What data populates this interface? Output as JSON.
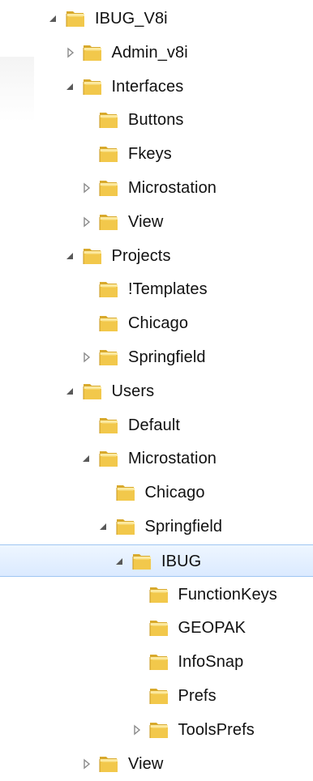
{
  "tree": {
    "items": [
      {
        "label": "IBUG_V8i",
        "expander": "expanded"
      },
      {
        "label": "Admin_v8i",
        "expander": "collapsed"
      },
      {
        "label": "Interfaces",
        "expander": "expanded"
      },
      {
        "label": "Buttons",
        "expander": "none"
      },
      {
        "label": "Fkeys",
        "expander": "none"
      },
      {
        "label": "Microstation",
        "expander": "collapsed"
      },
      {
        "label": "View",
        "expander": "collapsed"
      },
      {
        "label": "Projects",
        "expander": "expanded"
      },
      {
        "label": "!Templates",
        "expander": "none"
      },
      {
        "label": "Chicago",
        "expander": "none"
      },
      {
        "label": "Springfield",
        "expander": "collapsed"
      },
      {
        "label": "Users",
        "expander": "expanded"
      },
      {
        "label": "Default",
        "expander": "none"
      },
      {
        "label": "Microstation",
        "expander": "expanded"
      },
      {
        "label": "Chicago",
        "expander": "none"
      },
      {
        "label": "Springfield",
        "expander": "expanded"
      },
      {
        "label": "IBUG",
        "expander": "expanded",
        "selected": true
      },
      {
        "label": "FunctionKeys",
        "expander": "none"
      },
      {
        "label": "GEOPAK",
        "expander": "none"
      },
      {
        "label": "InfoSnap",
        "expander": "none"
      },
      {
        "label": "Prefs",
        "expander": "none"
      },
      {
        "label": "ToolsPrefs",
        "expander": "collapsed"
      },
      {
        "label": "View",
        "expander": "collapsed"
      }
    ]
  },
  "colors": {
    "selection_fill": "#dbeaff",
    "selection_border": "#9fc6f2",
    "folder_front": "#f2c84b",
    "folder_back": "#d8a92c",
    "text": "#111111",
    "expander": "#595959"
  }
}
